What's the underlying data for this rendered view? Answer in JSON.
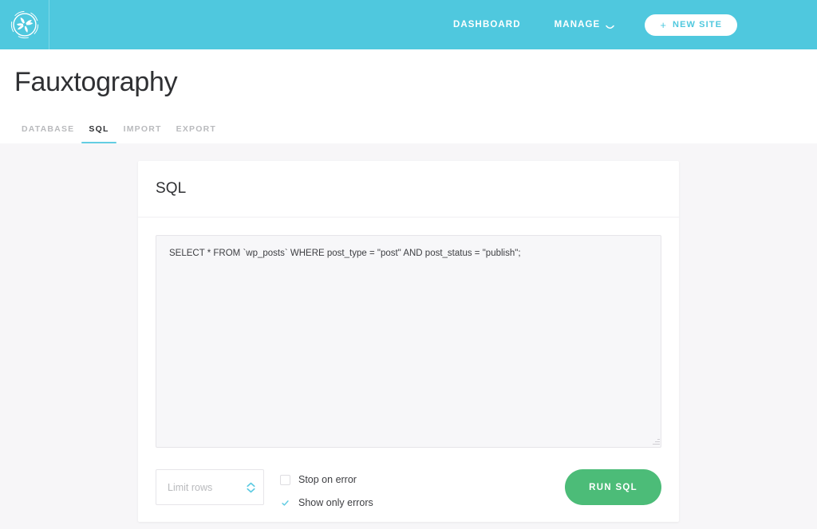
{
  "colors": {
    "brand_teal": "#4fc8de",
    "tab_underline": "#63cde2",
    "run_green": "#4cbc78",
    "page_bg": "#f7f6f8",
    "card_bg": "#ffffff",
    "text_dark": "#2f3033",
    "text_muted": "#b9babd"
  },
  "topnav": {
    "logo_icon": "pinwheel-logo-icon",
    "dashboard_label": "DASHBOARD",
    "manage_label": "MANAGE",
    "manage_caret_icon": "chevron-down-icon",
    "new_site_plus": "+",
    "new_site_label": "NEW SITE"
  },
  "subheader": {
    "site_title": "Fauxtography",
    "tabs": [
      {
        "label": "DATABASE",
        "active": false
      },
      {
        "label": "SQL",
        "active": true
      },
      {
        "label": "IMPORT",
        "active": false
      },
      {
        "label": "EXPORT",
        "active": false
      }
    ]
  },
  "card": {
    "title": "SQL",
    "sql_editor": {
      "value": "SELECT * FROM `wp_posts` WHERE post_type = \"post\" AND post_status = \"publish\";",
      "placeholder": "",
      "resize_handle_icon": "resize-grip-icon"
    },
    "controls": {
      "limit_rows": {
        "value": "",
        "placeholder": "Limit rows",
        "stepper_up_icon": "chevron-up-icon",
        "stepper_down_icon": "chevron-down-icon"
      },
      "checkboxes": [
        {
          "label": "Stop on error",
          "checked": false
        },
        {
          "label": "Show only errors",
          "checked": true
        }
      ],
      "run_button_label": "RUN SQL"
    }
  }
}
